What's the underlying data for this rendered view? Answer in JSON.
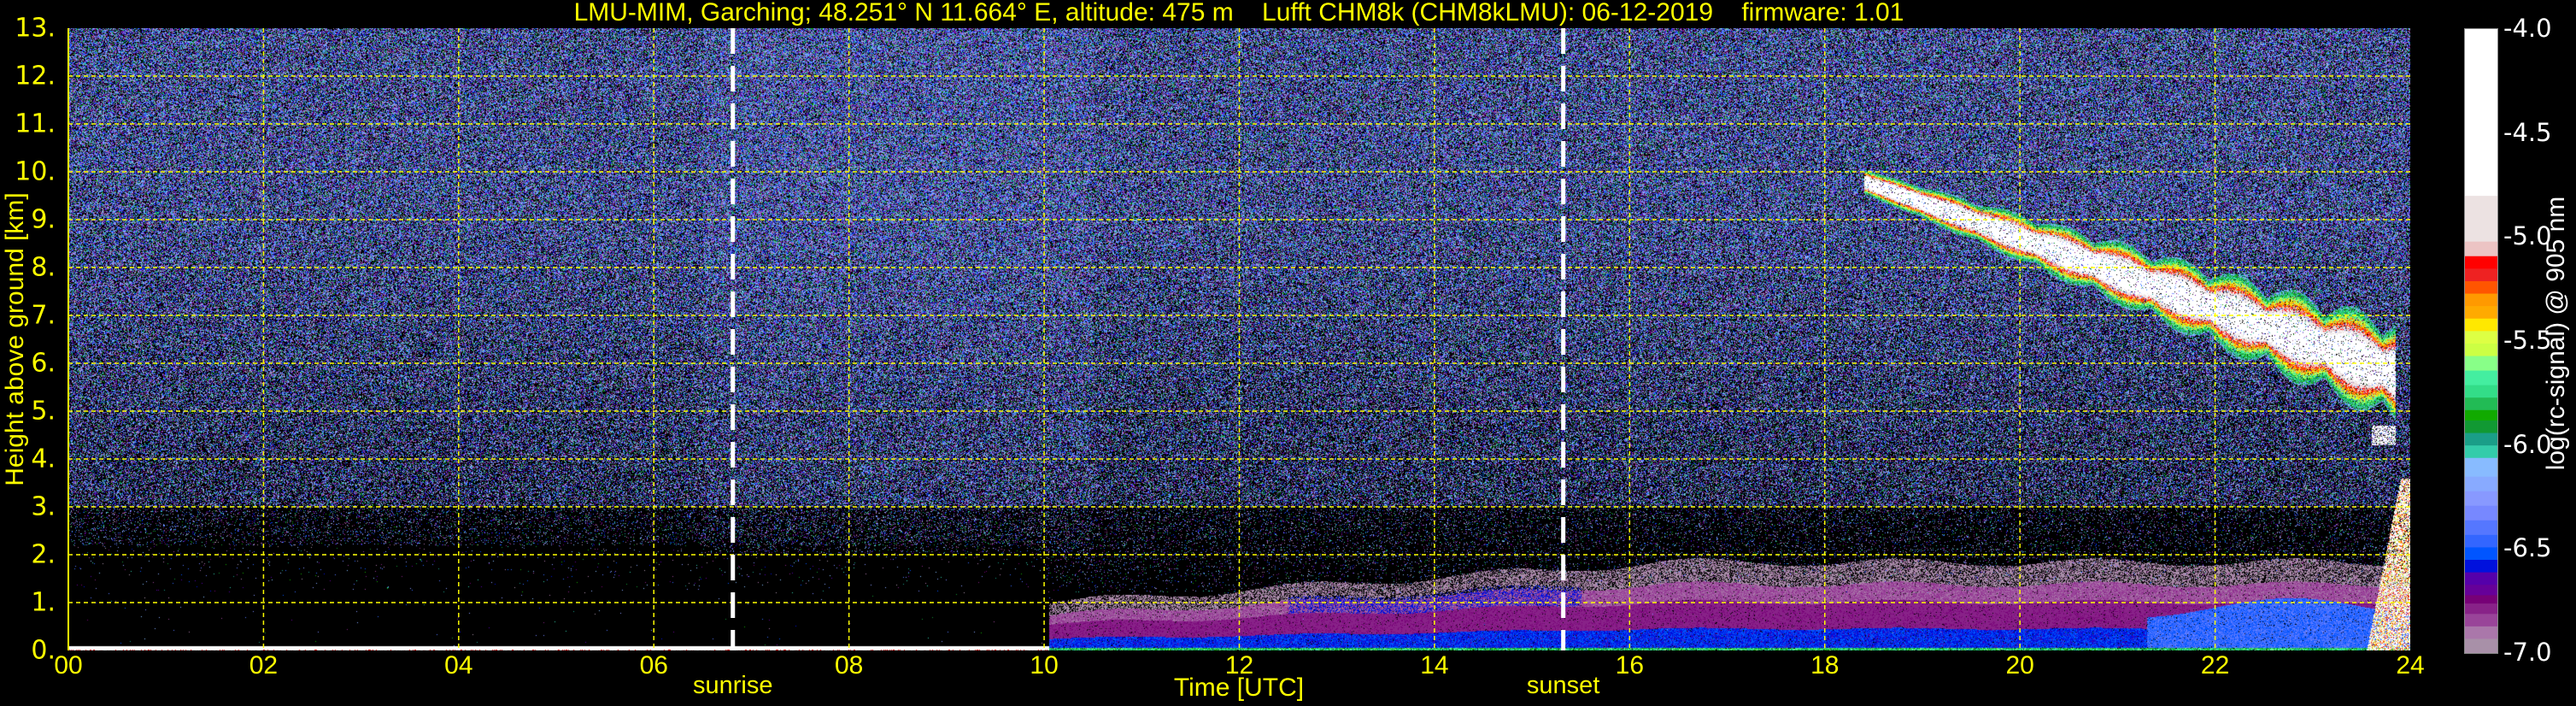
{
  "chart_data": {
    "type": "heatmap",
    "title": "LMU-MIM, Garching; 48.251° N 11.664° E, altitude: 475 m    Lufft CHM8k (CHM8kLMU): 06-12-2019    firmware: 1.01",
    "xlabel": "Time [UTC]",
    "ylabel": "Height above ground [km]",
    "xlim": [
      0,
      24
    ],
    "ylim": [
      0,
      13
    ],
    "grid": true,
    "x_ticks": [
      0,
      2,
      4,
      6,
      8,
      10,
      12,
      14,
      16,
      18,
      20,
      22,
      24
    ],
    "x_tick_labels": [
      "00",
      "02",
      "04",
      "06",
      "08",
      "10",
      "12",
      "14",
      "16",
      "18",
      "20",
      "22",
      "24"
    ],
    "y_ticks": [
      0,
      1,
      2,
      3,
      4,
      5,
      6,
      7,
      8,
      9,
      10,
      11,
      12,
      13
    ],
    "y_tick_labels": [
      "0.",
      "1.",
      "2.",
      "3.",
      "4.",
      "5.",
      "6.",
      "7.",
      "8.",
      "9.",
      "10.",
      "11.",
      "12.",
      "13."
    ],
    "annotations": [
      {
        "label": "sunrise",
        "x": 6.81
      },
      {
        "label": "sunset",
        "x": 15.32
      }
    ],
    "colorbar": {
      "label": "log(rc-signal) @ 905 nm",
      "range": [
        -7.0,
        -4.0
      ],
      "ticks": [
        -4.0,
        -4.5,
        -5.0,
        -5.5,
        -6.0,
        -6.5,
        -7.0
      ],
      "tick_labels": [
        "-4.0",
        "-4.5",
        "-5.0",
        "-5.5",
        "-6.0",
        "-6.5",
        "-7.0"
      ],
      "colors_low_to_high": [
        "#a890a8",
        "#aa77aa",
        "#994499",
        "#882288",
        "#770077",
        "#660099",
        "#5500aa",
        "#0011dd",
        "#0055ff",
        "#3366ff",
        "#5577ff",
        "#7788ff",
        "#8899ff",
        "#88aaff",
        "#88bbff",
        "#33ccaa",
        "#1a9e88",
        "#119933",
        "#11aa00",
        "#22bb55",
        "#33dd88",
        "#44eea0",
        "#88ff88",
        "#ccff44",
        "#ddff44",
        "#ffe800",
        "#ffaa00",
        "#ff9900",
        "#ff5500",
        "#ee2222",
        "#ff0000",
        "#ecc4c4",
        "#ece2e2",
        "#ffffff"
      ],
      "color_bounds": [
        -7.0,
        -6.93,
        -6.87,
        -6.81,
        -6.76,
        -6.72,
        -6.67,
        -6.61,
        -6.55,
        -6.49,
        -6.43,
        -6.36,
        -6.29,
        -6.22,
        -6.15,
        -6.06,
        -6.0,
        -5.94,
        -5.88,
        -5.83,
        -5.77,
        -5.71,
        -5.64,
        -5.57,
        -5.51,
        -5.45,
        -5.39,
        -5.33,
        -5.27,
        -5.21,
        -5.15,
        -5.09,
        -5.02,
        -4.8,
        -4.0
      ]
    },
    "layers": {
      "noise_floor_log": -6.3,
      "surface_layer": {
        "x": [
          0,
          10.05
        ],
        "top_km": 0.1,
        "value": -4.0
      },
      "boundary_layer": {
        "x": [
          10.05,
          24
        ],
        "top_km_start": 1.0,
        "top_km_end": 1.8,
        "value_range": [
          -7.0,
          -6.4
        ]
      },
      "high_cloud": {
        "x": [
          18.4,
          23.85
        ],
        "height_km_start": 9.8,
        "height_km_end": 5.8,
        "value_range": [
          -6.0,
          -4.0
        ]
      },
      "low_cloud": {
        "x": [
          23.55,
          24
        ],
        "top_km": 3.6,
        "value_range": [
          -5.5,
          -4.0
        ]
      }
    }
  }
}
